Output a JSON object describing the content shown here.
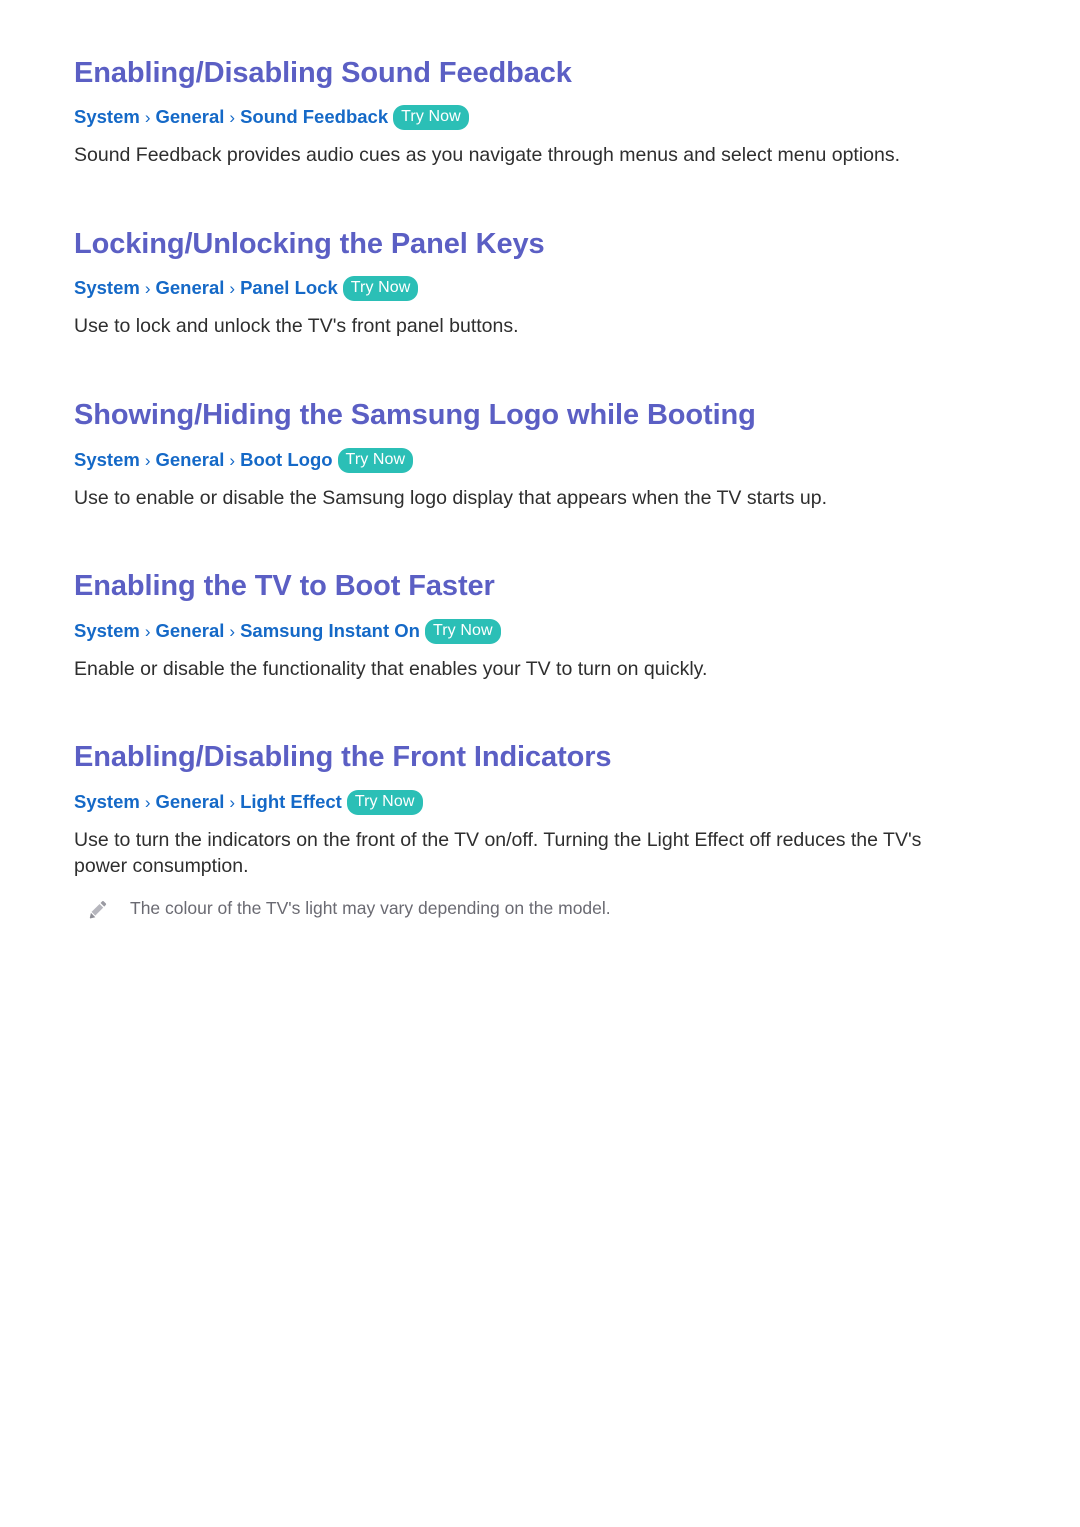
{
  "page": {
    "accent_heading_color": "#5b5fc4",
    "breadcrumb_color": "#1569c7",
    "badge_color": "#2bbfb6",
    "body_text_color": "#2e2e2e",
    "note_text_color": "#6a6a72",
    "background_color": "#ffffff"
  },
  "sections": [
    {
      "heading": "Enabling/Disabling Sound Feedback",
      "breadcrumb": {
        "crumbs": [
          "System",
          "General",
          "Sound Feedback"
        ],
        "separator": "›",
        "badge": "Try Now"
      },
      "body": "Sound Feedback provides audio cues as you navigate through menus and select menu options.",
      "note": null
    },
    {
      "heading": "Locking/Unlocking the Panel Keys",
      "breadcrumb": {
        "crumbs": [
          "System",
          "General",
          "Panel Lock"
        ],
        "separator": "›",
        "badge": "Try Now"
      },
      "body": "Use to lock and unlock the TV's front panel buttons.",
      "note": null
    },
    {
      "heading": "Showing/Hiding the Samsung Logo while Booting",
      "breadcrumb": {
        "crumbs": [
          "System",
          "General",
          "Boot Logo"
        ],
        "separator": "›",
        "badge": "Try Now"
      },
      "body": "Use to enable or disable the Samsung logo display that appears when the TV starts up.",
      "note": null
    },
    {
      "heading": "Enabling the TV to Boot Faster",
      "breadcrumb": {
        "crumbs": [
          "System",
          "General",
          "Samsung Instant On"
        ],
        "separator": "›",
        "badge": "Try Now"
      },
      "body": "Enable or disable the functionality that enables your TV to turn on quickly.",
      "note": null
    },
    {
      "heading": "Enabling/Disabling the Front Indicators",
      "breadcrumb": {
        "crumbs": [
          "System",
          "General",
          "Light Effect"
        ],
        "separator": "›",
        "badge": "Try Now"
      },
      "body": "Use to turn the indicators on the front of the TV on/off. Turning the Light Effect off reduces the TV's power consumption.",
      "note": {
        "icon": "pencil-icon",
        "text": "The colour of the TV's light may vary depending on the model."
      }
    }
  ]
}
